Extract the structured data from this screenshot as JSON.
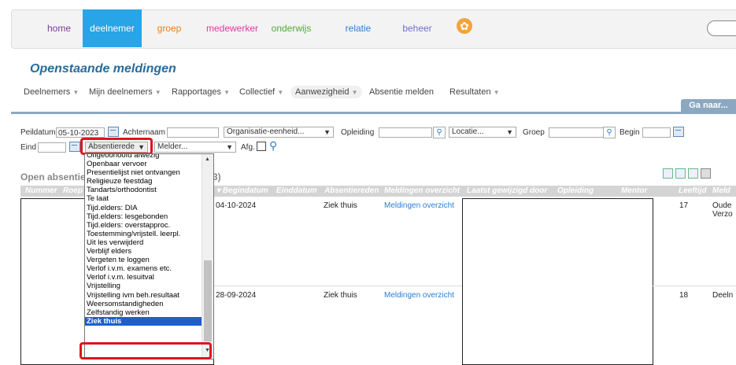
{
  "nav": {
    "home": "home",
    "deelnemer": "deelnemer",
    "groep": "groep",
    "medewerker": "medewerker",
    "onderwijs": "onderwijs",
    "relatie": "relatie",
    "beheer": "beheer",
    "logo_icon": "flower-logo-icon"
  },
  "page_title": "Openstaande meldingen",
  "subnav": [
    {
      "label": "Deelnemers",
      "dropdown": true
    },
    {
      "label": "Mijn deelnemers",
      "dropdown": true
    },
    {
      "label": "Rapportages",
      "dropdown": true
    },
    {
      "label": "Collectief",
      "dropdown": true
    },
    {
      "label": "Aanwezigheid",
      "dropdown": true
    },
    {
      "label": "Absentie melden",
      "dropdown": false
    },
    {
      "label": "Resultaten",
      "dropdown": true
    }
  ],
  "ga_naar": "Ga naar...",
  "filters": {
    "peildatum_label": "Peildatum",
    "peildatum_value": "05-10-2023",
    "achternaam_label": "Achternaam",
    "achternaam_value": "",
    "organisatie_value": "Organisatie-eenheid...",
    "opleiding_label": "Opleiding",
    "opleiding_value": "",
    "locatie_value": "Locatie...",
    "groep_label": "Groep",
    "groep_value": "",
    "begin_label": "Begin",
    "begin_value": "",
    "eind_label": "Eind",
    "eind_value": "",
    "absentiereden_value": "Absentierede",
    "melder_value": "Melder...",
    "afg_label": "Afg."
  },
  "section_title": "Open absentie",
  "section_title_suffix": "3)",
  "columns": [
    "Nummer",
    "Roep",
    "Begindatum",
    "Einddatum",
    "Absentiereden",
    "Meldingen overzicht",
    "Laatst gewijzigd door",
    "Opleiding",
    "Mentor",
    "Leeftijd",
    "Meld"
  ],
  "rows": [
    {
      "begindatum": "04-10-2024",
      "absentiereden": "Ziek thuis",
      "meldingen": "Meldingen overzicht",
      "leeftijd": "17",
      "meld1": "Oude",
      "meld2": "Verzo"
    },
    {
      "begindatum": "28-09-2024",
      "absentiereden": "Ziek thuis",
      "meldingen": "Meldingen overzicht",
      "leeftijd": "18",
      "meld1": "Deeln",
      "meld2": ""
    }
  ],
  "dropdown_options": [
    "Ongeoorloofd afwezig",
    "Openbaar vervoer",
    "Presentielijst niet ontvangen",
    "Religieuze feestdag",
    "Tandarts/orthodontist",
    "Te laat",
    "Tijd.elders: DIA",
    "Tijd.elders: lesgebonden",
    "Tijd.elders: overstapproc.",
    "Toestemming/vrijstell. leerpl.",
    "Uit les verwijderd",
    "Verblijf elders",
    "Vergeten te loggen",
    "Verlof i.v.m. examens etc.",
    "Verlof i.v.m. lesuitval",
    "Vrijstelling",
    "Vrijstelling ivm beh.resultaat",
    "Weersomstandigheden",
    "Zelfstandig werken",
    "Ziek thuis"
  ],
  "selected_option": "Ziek thuis",
  "colors": {
    "accent": "#27a5e6",
    "highlight": "#e0141e",
    "selection": "#1e5fc8"
  }
}
